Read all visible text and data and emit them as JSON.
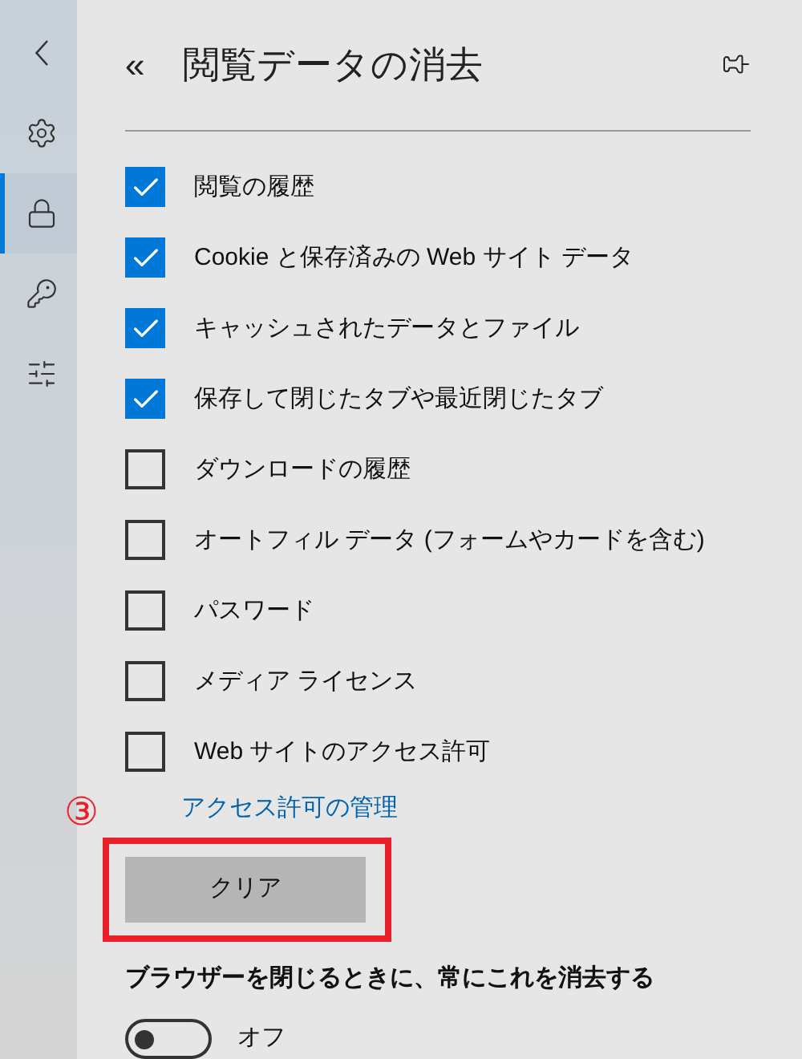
{
  "sidebar": {
    "items": [
      {
        "kind": "back",
        "selected": false
      },
      {
        "kind": "gear",
        "selected": false
      },
      {
        "kind": "lock",
        "selected": true
      },
      {
        "kind": "key",
        "selected": false
      },
      {
        "kind": "sliders",
        "selected": false
      }
    ]
  },
  "panel": {
    "back_glyph": "«",
    "title": "閲覧データの消去"
  },
  "options": [
    {
      "label": "閲覧の履歴",
      "checked": true
    },
    {
      "label": "Cookie と保存済みの Web サイト データ",
      "checked": true
    },
    {
      "label": "キャッシュされたデータとファイル",
      "checked": true
    },
    {
      "label": "保存して閉じたタブや最近閉じたタブ",
      "checked": true
    },
    {
      "label": "ダウンロードの履歴",
      "checked": false
    },
    {
      "label": "オートフィル データ (フォームやカードを含む)",
      "checked": false
    },
    {
      "label": "パスワード",
      "checked": false
    },
    {
      "label": "メディア ライセンス",
      "checked": false
    },
    {
      "label": "Web サイトのアクセス許可",
      "checked": false
    }
  ],
  "permissions_link": "アクセス許可の管理",
  "annotation": {
    "number": "③"
  },
  "clear_button": "クリア",
  "always_clear": {
    "label": "ブラウザーを閉じるときに、常にこれを消去する",
    "on": false,
    "state_text": "オフ"
  }
}
